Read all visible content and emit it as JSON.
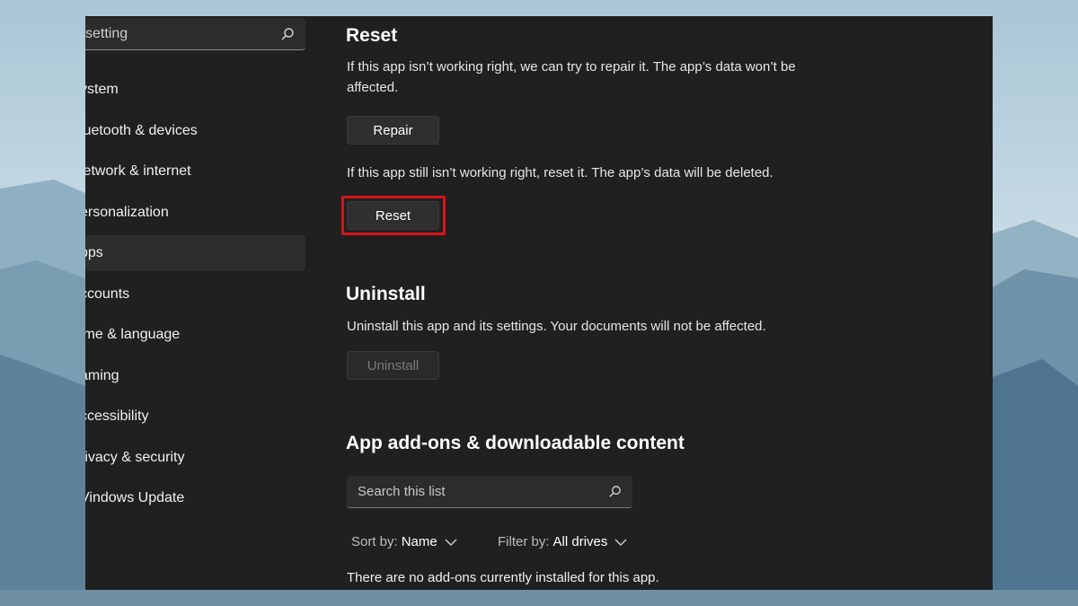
{
  "sidebar": {
    "search": {
      "value": "setting"
    },
    "items": [
      {
        "label": "ystem"
      },
      {
        "label": "luetooth & devices"
      },
      {
        "label": "letwork & internet"
      },
      {
        "label": "ersonalization"
      },
      {
        "label": "pps",
        "active": true
      },
      {
        "label": "ccounts"
      },
      {
        "label": "ime & language"
      },
      {
        "label": "aming"
      },
      {
        "label": "ccessibility"
      },
      {
        "label": "rivacy & security"
      },
      {
        "label": "Vindows Update"
      }
    ]
  },
  "reset_section": {
    "title": "Reset",
    "repair_desc": "If this app isn’t working right, we can try to repair it. The app’s data won’t be affected.",
    "repair_label": "Repair",
    "reset_desc": "If this app still isn’t working right, reset it. The app’s data will be deleted.",
    "reset_label": "Reset",
    "highlight_color": "#d8141c"
  },
  "uninstall_section": {
    "title": "Uninstall",
    "desc": "Uninstall this app and its settings. Your documents will not be affected.",
    "button_label": "Uninstall"
  },
  "addons_section": {
    "title": "App add-ons & downloadable content",
    "search_placeholder": "Search this list",
    "sort_label": "Sort by:",
    "sort_value": "Name",
    "filter_label": "Filter by:",
    "filter_value": "All drives",
    "empty_message": "There are no add-ons currently installed for this app."
  },
  "colors": {
    "window_bg": "#202020",
    "active_item_bg": "#2d2d2d"
  }
}
